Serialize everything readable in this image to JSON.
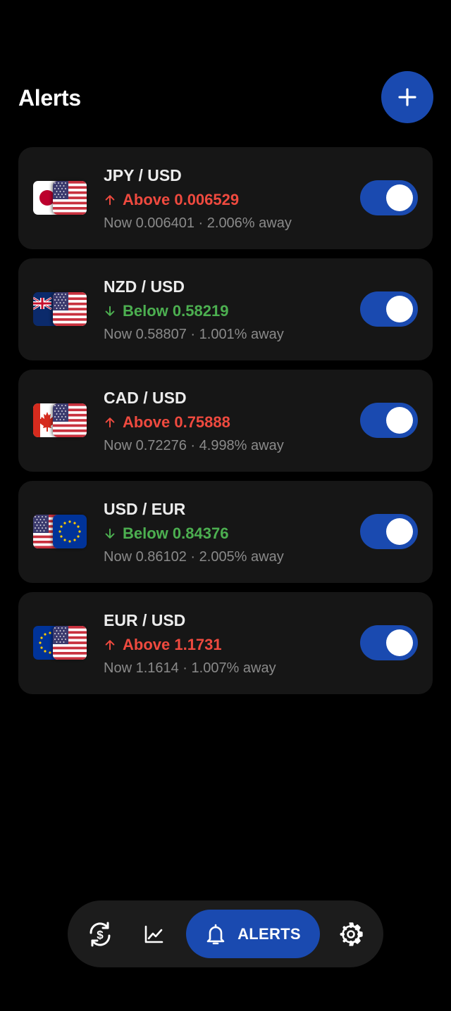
{
  "header": {
    "title": "Alerts"
  },
  "colors": {
    "accent": "#1a4ab0",
    "above": "#ef4a3f",
    "below": "#4caf50",
    "card": "#161616"
  },
  "alerts": [
    {
      "pair": "JPY / USD",
      "condition": "Above 0.006529",
      "direction": "up",
      "now": "Now 0.006401 · 2.006% away",
      "enabled": true,
      "base_flag": "japan-flag-icon",
      "quote_flag": "us-flag-icon"
    },
    {
      "pair": "NZD / USD",
      "condition": "Below 0.58219",
      "direction": "down",
      "now": "Now 0.58807 · 1.001% away",
      "enabled": true,
      "base_flag": "new-zealand-flag-icon",
      "quote_flag": "us-flag-icon"
    },
    {
      "pair": "CAD / USD",
      "condition": "Above 0.75888",
      "direction": "up",
      "now": "Now 0.72276 · 4.998% away",
      "enabled": true,
      "base_flag": "canada-flag-icon",
      "quote_flag": "us-flag-icon"
    },
    {
      "pair": "USD / EUR",
      "condition": "Below 0.84376",
      "direction": "down",
      "now": "Now 0.86102 · 2.005% away",
      "enabled": true,
      "base_flag": "us-flag-icon",
      "quote_flag": "eu-flag-icon"
    },
    {
      "pair": "EUR / USD",
      "condition": "Above 1.1731",
      "direction": "up",
      "now": "Now 1.1614 · 1.007% away",
      "enabled": true,
      "base_flag": "eu-flag-icon",
      "quote_flag": "us-flag-icon"
    }
  ],
  "nav": {
    "items": [
      {
        "icon": "currency-exchange-icon"
      },
      {
        "icon": "chart-icon"
      },
      {
        "icon": "bell-icon",
        "label": "ALERTS",
        "active": true
      },
      {
        "icon": "gear-icon"
      }
    ]
  }
}
